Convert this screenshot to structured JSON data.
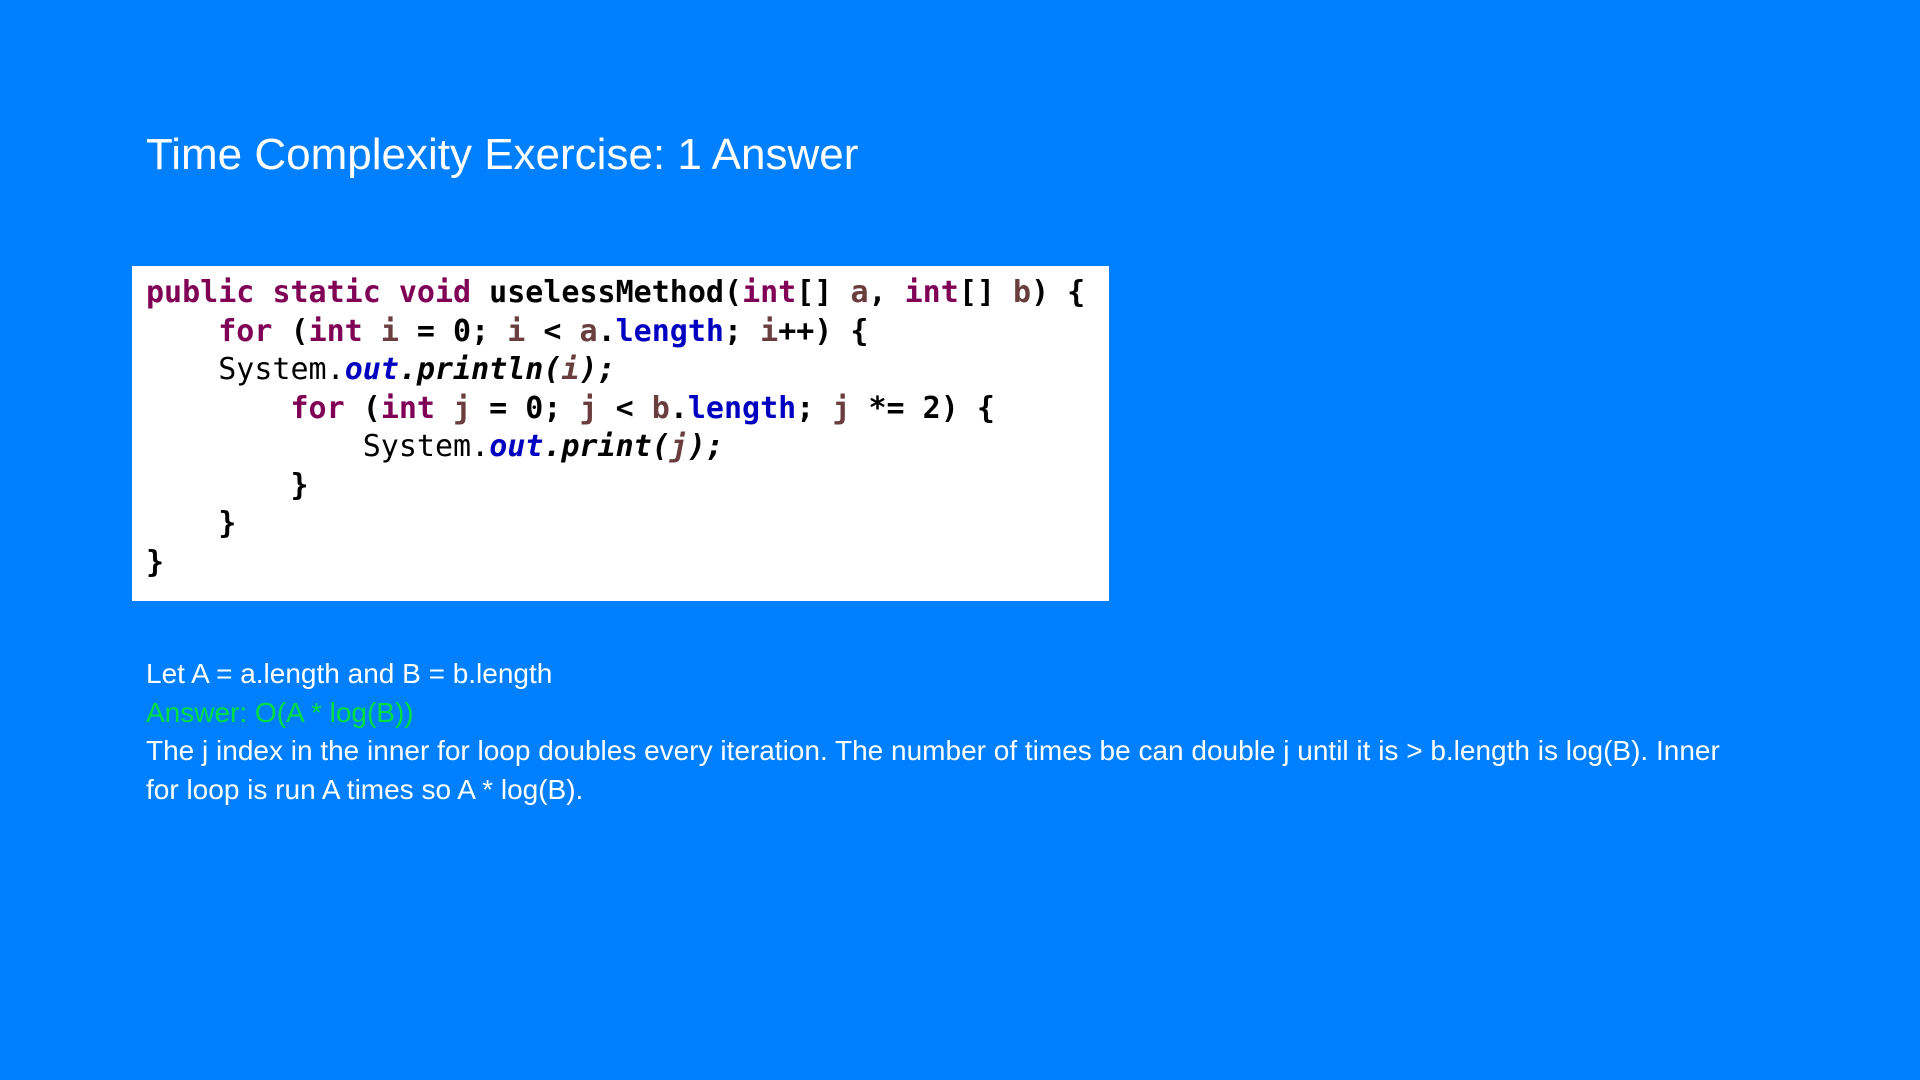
{
  "slide": {
    "title": "Time Complexity Exercise: 1 Answer",
    "code": {
      "line1": {
        "t1": "public",
        "t2": " ",
        "t3": "static",
        "t4": " ",
        "t5": "void",
        "t6": " uselessMethod(",
        "t7": "int",
        "t8": "[] ",
        "t9": "a",
        "t10": ", ",
        "t11": "int",
        "t12": "[] ",
        "t13": "b",
        "t14": ") {"
      },
      "line2": {
        "t0": "    ",
        "t1": "for",
        "t2": " (",
        "t3": "int",
        "t4": " ",
        "t5": "i",
        "t6": " = 0; ",
        "t7": "i",
        "t8": " < ",
        "t9": "a",
        "t10": ".",
        "t11": "length",
        "t12": "; ",
        "t13": "i",
        "t14": "++) {"
      },
      "line3": {
        "t0": "    ",
        "t1": "System.",
        "t2": "out",
        "t3": ".println(",
        "t4": "i",
        "t5": ");"
      },
      "line4": {
        "t0": "        ",
        "t1": "for",
        "t2": " (",
        "t3": "int",
        "t4": " ",
        "t5": "j",
        "t6": " = 0; ",
        "t7": "j",
        "t8": " < ",
        "t9": "b",
        "t10": ".",
        "t11": "length",
        "t12": "; ",
        "t13": "j",
        "t14": " *= 2) {"
      },
      "line5": {
        "t0": "            ",
        "t1": "System.",
        "t2": "out",
        "t3": ".print(",
        "t4": "j",
        "t5": ");"
      },
      "line6": "        }",
      "line7": "    }",
      "line8": "}"
    },
    "let_text": "Let A = a.length and B = b.length",
    "answer_text": "Answer: O(A *  log(B))",
    "explanation_line1": "The j index in the inner for loop doubles every iteration. The number of times be can double j until it is > b.length is log(B). Inner",
    "explanation_line2": "for loop is run A times so A * log(B)."
  },
  "colors": {
    "background": "#0080ff",
    "keyword": "#7f0055",
    "variable": "#6a3e3e",
    "field": "#0000c0",
    "answer": "#00e040"
  }
}
